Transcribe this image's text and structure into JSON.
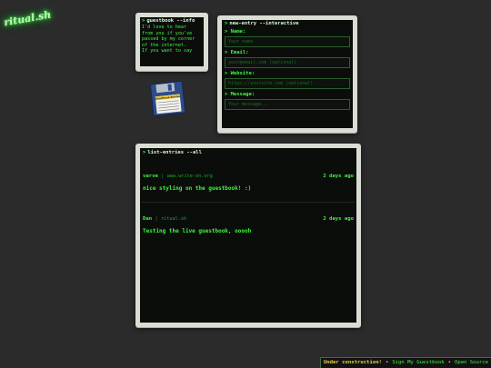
{
  "logo": {
    "text": "ritual.sh"
  },
  "info_window": {
    "title": "guestbook --info",
    "lines": [
      "I'd love to hear",
      "from you if you've",
      "passed by my corner",
      "of the internet.",
      "If you want to say"
    ]
  },
  "entry_window": {
    "title": "new-entry --interactive",
    "fields": [
      {
        "label": "Name:",
        "placeholder": "Your name"
      },
      {
        "label": "Email:",
        "placeholder": "your@email.com (optional)"
      },
      {
        "label": "Website:",
        "placeholder": "https://yoursite.com (optional)"
      },
      {
        "label": "Message:",
        "placeholder": "Your message..."
      }
    ]
  },
  "list_window": {
    "title": "list-entries --all",
    "entries": [
      {
        "name": "varve",
        "sep": "|",
        "site": "www.write-on.org",
        "time": "2 days ago",
        "message": "nice styling on the guestbook! :)"
      },
      {
        "name": "Dan",
        "sep": "|",
        "site": "ritual.sh",
        "time": "2 days ago",
        "message": "Testing the live guestbook,  ooooh"
      }
    ]
  },
  "floppy": {
    "label": "Guestbook Entries"
  },
  "statusbar": {
    "warning": "Under construction!",
    "link1": "Sign My Guestbook",
    "link2": "Open Source"
  },
  "colors": {
    "terminal_green": "#34ff3a",
    "bezel": "#d9ddd3",
    "background": "#2b2b2b",
    "warning": "#e8d23b"
  }
}
